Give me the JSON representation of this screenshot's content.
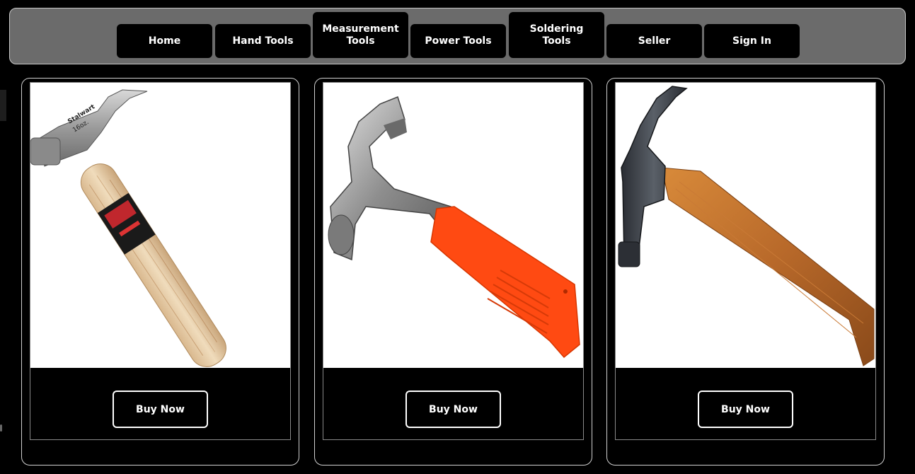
{
  "nav": {
    "items": [
      {
        "label": "Home"
      },
      {
        "label": "Hand Tools"
      },
      {
        "label_line1": "Measurement",
        "label_line2": "Tools"
      },
      {
        "label": "Power Tools"
      },
      {
        "label_line1": "Soldering",
        "label_line2": "Tools"
      },
      {
        "label": "Seller"
      },
      {
        "label": "Sign In"
      }
    ]
  },
  "products": [
    {
      "buy_label": "Buy Now",
      "icon": "claw-hammer-wood-handle",
      "brand_on_image": "Stalwart",
      "weight_on_image": "16oz."
    },
    {
      "buy_label": "Buy Now",
      "icon": "claw-hammer-orange-grip"
    },
    {
      "buy_label": "Buy Now",
      "icon": "claw-hammer-dark-wood-handle"
    }
  ],
  "colors": {
    "background": "#000000",
    "navbar": "#6b6b6b",
    "button": "#000000",
    "button_text": "#ffffff",
    "orange_grip": "#ff4a12"
  }
}
